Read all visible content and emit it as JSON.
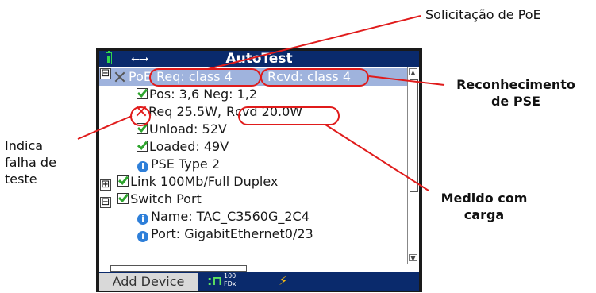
{
  "annotations": {
    "poe_request": "Solicitação de PoE",
    "pse_ack": [
      "Reconhecimento",
      "de PSE"
    ],
    "test_fail": [
      "Indica",
      "falha de",
      "teste"
    ],
    "measured_load": [
      "Medido com",
      "carga"
    ]
  },
  "titlebar": {
    "title": "AutoTest"
  },
  "tree": {
    "poe": {
      "expander": "⊟",
      "label": "PoE",
      "req": "Req: class 4",
      "rcvd": "Rcvd: class 4"
    },
    "pos_neg": "Pos: 3,6 Neg: 1,2",
    "req_power": "Req 25.5W,",
    "rcvd_power": "Rcvd 20.0W",
    "unload": "Unload: 52V",
    "loaded": "Loaded: 49V",
    "pse_type": "PSE Type 2",
    "link": {
      "expander": "⊞",
      "label": "Link 100Mb/Full Duplex"
    },
    "switch": {
      "expander": "⊟",
      "label": "Switch Port"
    },
    "sw_name": "Name: TAC_C3560G_2C4",
    "sw_port": "Port: GigabitEthernet0/23"
  },
  "bottombar": {
    "add_device": "Add Device",
    "speed": "100",
    "duplex": "FDx"
  },
  "colors": {
    "titlebar": "#0a2a6c",
    "selection": "#9fb3dd",
    "callout": "#e01b1b",
    "pass": "#2ea52e"
  }
}
